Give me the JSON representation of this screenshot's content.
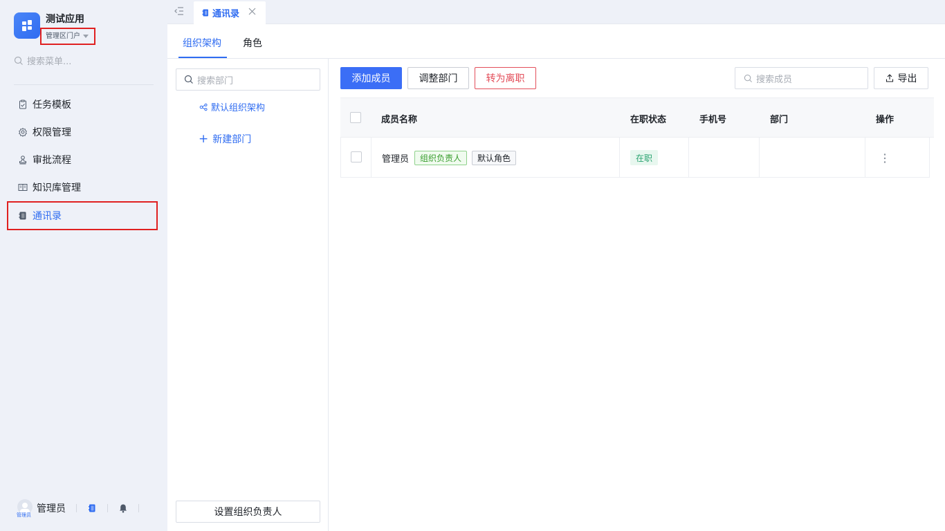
{
  "app": {
    "name": "测试应用",
    "portal": "管理区门户"
  },
  "sidebar": {
    "search_placeholder": "搜索菜单...",
    "items": [
      {
        "label": "任务模板"
      },
      {
        "label": "权限管理"
      },
      {
        "label": "审批流程"
      },
      {
        "label": "知识库管理"
      },
      {
        "label": "通讯录"
      }
    ],
    "footer": {
      "user_name": "管理员",
      "avatar_text": "管理员"
    }
  },
  "tabs": {
    "open_tab": "通讯录"
  },
  "subtabs": [
    "组织架构",
    "角色"
  ],
  "dept": {
    "search_placeholder": "搜索部门",
    "root": "默认组织架构",
    "new_label": "新建部门",
    "set_leader": "设置组织负责人"
  },
  "toolbar": {
    "add_member": "添加成员",
    "adjust_dept": "调整部门",
    "resign": "转为离职",
    "search_placeholder": "搜索成员",
    "export": "导出"
  },
  "table": {
    "headers": [
      "成员名称",
      "在职状态",
      "手机号",
      "部门",
      "操作"
    ],
    "rows": [
      {
        "name": "管理员",
        "tags": [
          "组织负责人",
          "默认角色"
        ],
        "status": "在职",
        "phone": "",
        "dept": ""
      }
    ]
  },
  "colors": {
    "accent": "#2f6cf1",
    "primary_button": "#3b6ef6",
    "danger": "#e34d59",
    "success": "#2ba471",
    "highlight_box": "#e02020",
    "sidebar_bg": "#eef1f8"
  }
}
